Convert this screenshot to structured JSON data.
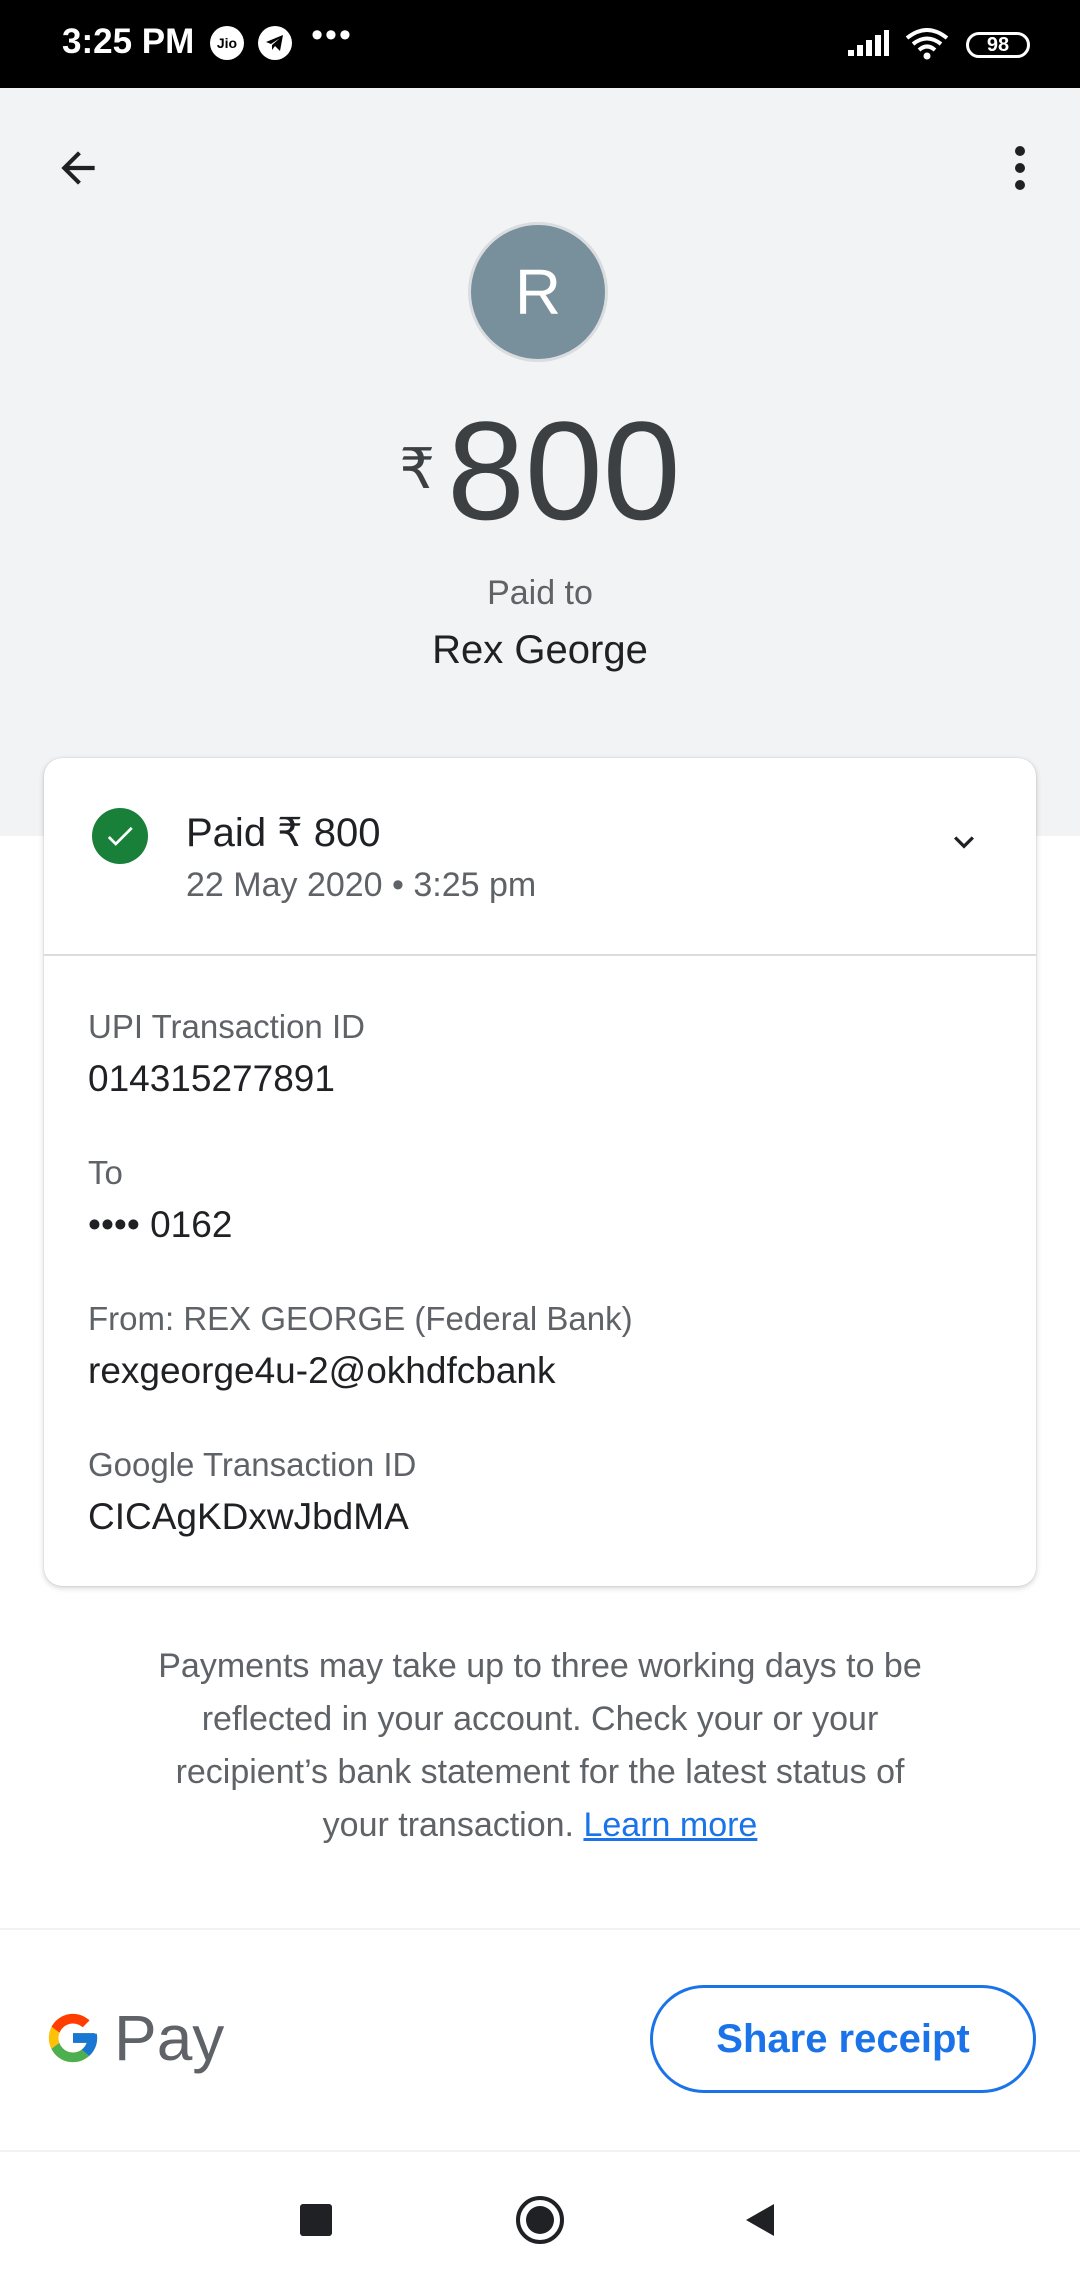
{
  "status_bar": {
    "time": "3:25 PM",
    "carrier_icon": "Jio",
    "battery": "98",
    "icons": [
      "jio-icon",
      "telegram-icon",
      "more-notifications-icon",
      "signal-icon",
      "wifi-icon",
      "battery-icon"
    ]
  },
  "header": {
    "back_icon": "arrow-back-icon",
    "menu_icon": "more-vert-icon",
    "avatar_initial": "R",
    "currency_symbol": "₹",
    "amount": "800",
    "paid_to_label": "Paid to",
    "payee_name": "Rex George"
  },
  "card": {
    "status_icon": "check-circle-icon",
    "title": "Paid ₹ 800",
    "datetime": "22 May 2020 • 3:25 pm",
    "expand_icon": "chevron-down-icon",
    "details": [
      {
        "label": "UPI Transaction ID",
        "value": "014315277891"
      },
      {
        "label": "To",
        "value": "•••• 0162"
      },
      {
        "label": "From: REX GEORGE (Federal Bank)",
        "value": "rexgeorge4u-2@okhdfcbank"
      },
      {
        "label": "Google Transaction ID",
        "value": "CICAgKDxwJbdMA"
      }
    ]
  },
  "notice": {
    "text": "Payments may take up to three working days to be reflected in your account. Check your or your recipient’s bank statement for the latest status of your transaction.",
    "link": "Learn more"
  },
  "footer": {
    "brand_pay": "Pay",
    "share_label": "Share receipt"
  },
  "nav_bar": {
    "icons": [
      "recents-square-icon",
      "home-circle-icon",
      "back-triangle-icon"
    ]
  },
  "colors": {
    "accent": "#1a73e8",
    "success": "#188038",
    "avatar_bg": "#78909c",
    "header_bg": "#f1f3f4"
  }
}
